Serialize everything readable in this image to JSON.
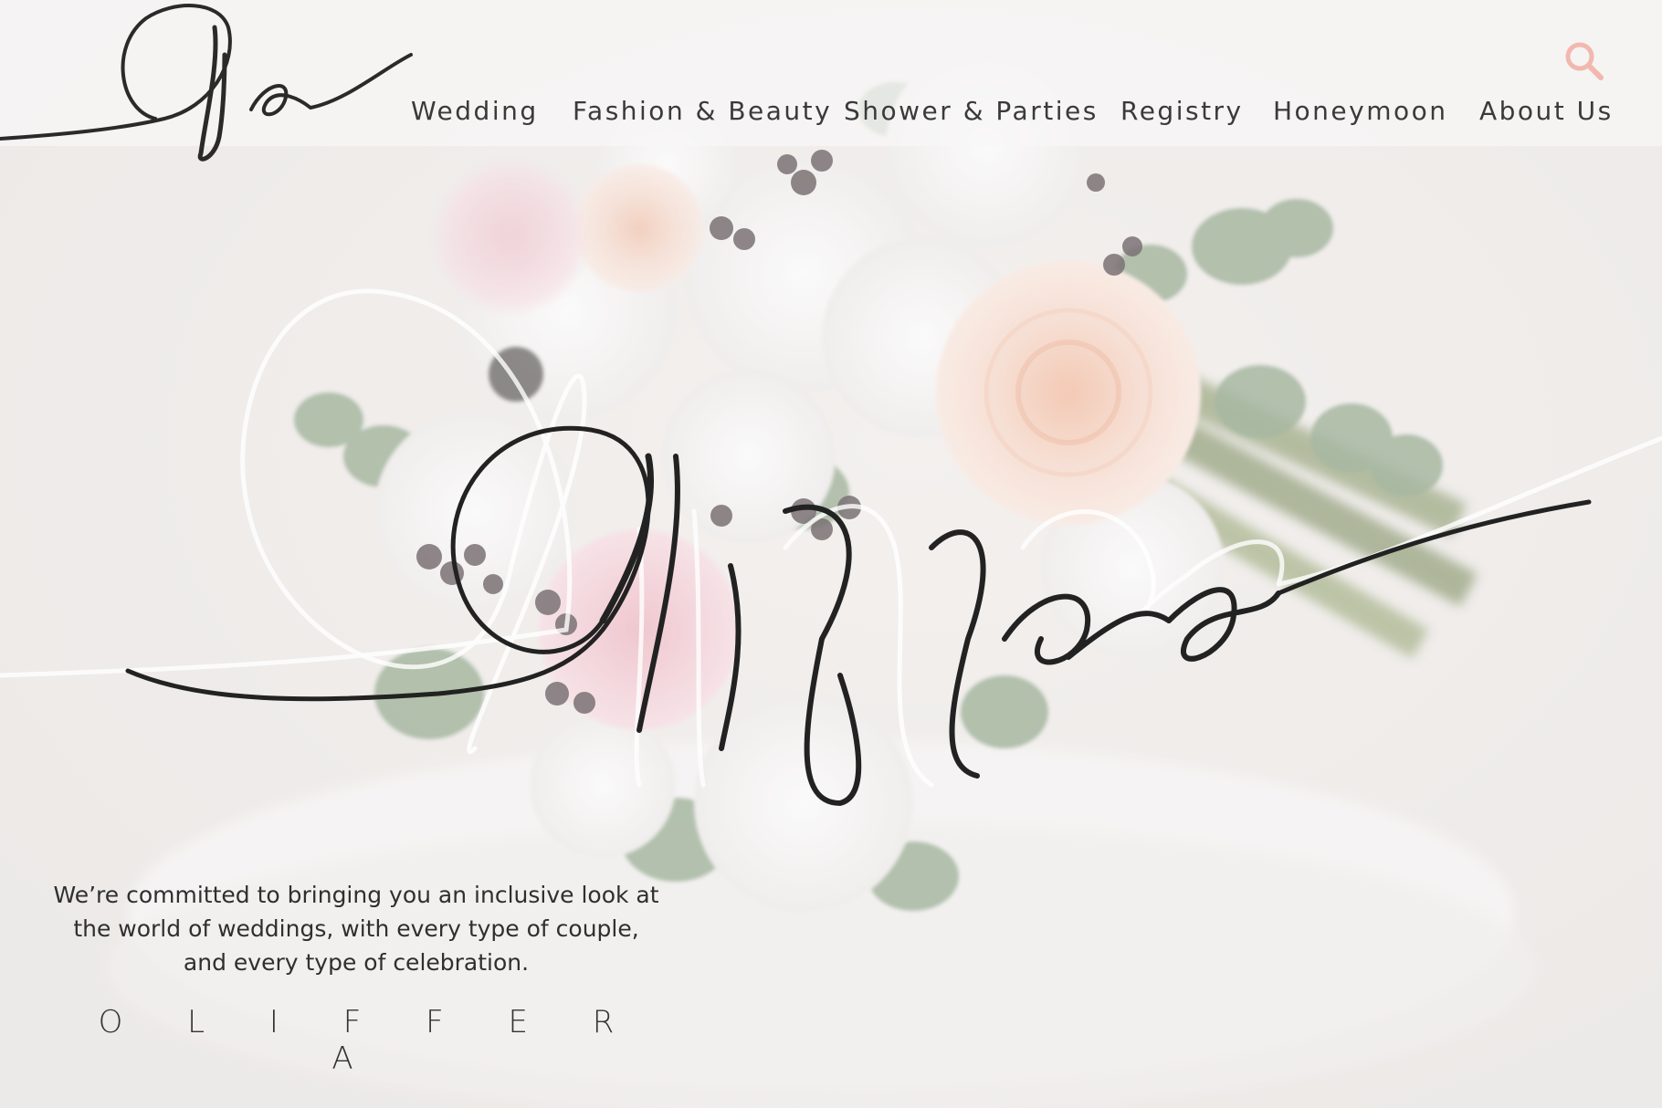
{
  "brand": {
    "monogram": "Oa",
    "script_name": "Oliffera",
    "wordmark": "O L I F F E R A"
  },
  "nav": {
    "items": [
      {
        "label": "Wedding",
        "icon": null
      },
      {
        "label": "Fashion & Beauty",
        "icon": null
      },
      {
        "label": "Shower & Parties",
        "icon": null
      },
      {
        "label": "Registry",
        "icon": null
      },
      {
        "label": "Honeymoon",
        "icon": null
      },
      {
        "label": "About Us",
        "icon": null
      }
    ],
    "search_icon": "search-icon"
  },
  "tagline": {
    "line1": "We’re committed to bringing you an inclusive look at",
    "line2": "the world of weddings, with every type of couple,",
    "line3": "and every type of celebration."
  },
  "colors": {
    "accent": "#f2b8b0",
    "text": "#333333",
    "background": "#efecea"
  }
}
